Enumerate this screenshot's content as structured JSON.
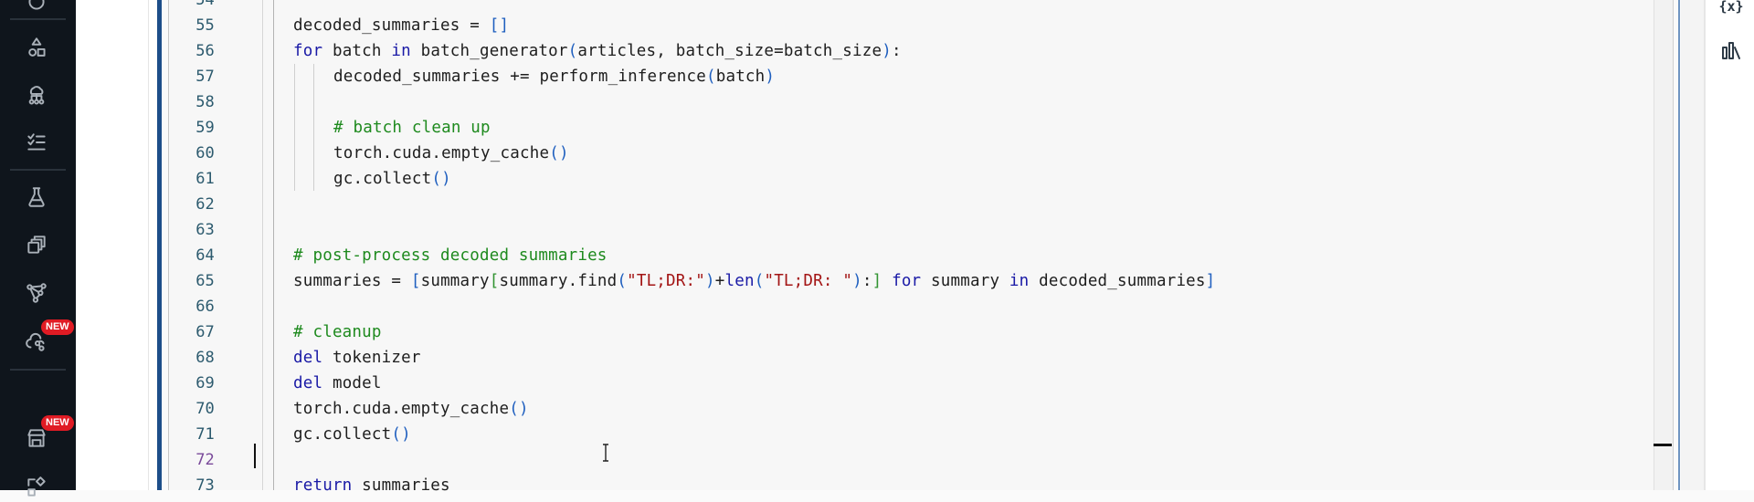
{
  "sidebar": {
    "items": [
      {
        "icon": "shapes-icon",
        "label": "Components"
      },
      {
        "icon": "hierarchy-icon",
        "label": "Pipelines"
      },
      {
        "icon": "checklist-icon",
        "label": "Tasks"
      },
      {
        "icon": "flask-icon",
        "label": "Experiments"
      },
      {
        "icon": "stack-icon",
        "label": "Models"
      },
      {
        "icon": "network-icon",
        "label": "Endpoints"
      },
      {
        "icon": "cloud-link-icon",
        "label": "Connections",
        "badge": "NEW"
      },
      {
        "icon": "store-icon",
        "label": "Marketplace",
        "badge": "NEW"
      },
      {
        "icon": "shapes-tool-icon",
        "label": "Tools"
      }
    ],
    "badge_color": "#e01b24"
  },
  "editor": {
    "top_partial_line": "54",
    "active_line": "72",
    "lines": [
      {
        "num": "55",
        "indent": 0,
        "tokens": [
          {
            "t": "decoded_summaries = ",
            "c": ""
          },
          {
            "t": "[]",
            "c": "br1"
          }
        ]
      },
      {
        "num": "56",
        "indent": 0,
        "tokens": [
          {
            "t": "for",
            "c": "kw"
          },
          {
            "t": " batch ",
            "c": ""
          },
          {
            "t": "in",
            "c": "kw"
          },
          {
            "t": " batch_generator",
            "c": ""
          },
          {
            "t": "(",
            "c": "br1"
          },
          {
            "t": "articles, batch_size=batch_size",
            "c": ""
          },
          {
            "t": ")",
            "c": "br1"
          },
          {
            "t": ":",
            "c": ""
          }
        ]
      },
      {
        "num": "57",
        "indent": 1,
        "tokens": [
          {
            "t": "decoded_summaries += perform_inference",
            "c": ""
          },
          {
            "t": "(",
            "c": "br1"
          },
          {
            "t": "batch",
            "c": ""
          },
          {
            "t": ")",
            "c": "br1"
          }
        ]
      },
      {
        "num": "58",
        "indent": 1,
        "tokens": []
      },
      {
        "num": "59",
        "indent": 1,
        "tokens": [
          {
            "t": "# batch clean up",
            "c": "cm"
          }
        ]
      },
      {
        "num": "60",
        "indent": 1,
        "tokens": [
          {
            "t": "torch.cuda.empty_cache",
            "c": ""
          },
          {
            "t": "()",
            "c": "br1"
          }
        ]
      },
      {
        "num": "61",
        "indent": 1,
        "tokens": [
          {
            "t": "gc.collect",
            "c": ""
          },
          {
            "t": "()",
            "c": "br1"
          }
        ]
      },
      {
        "num": "62",
        "indent": 0,
        "tokens": []
      },
      {
        "num": "63",
        "indent": 0,
        "tokens": []
      },
      {
        "num": "64",
        "indent": 0,
        "tokens": [
          {
            "t": "# post-process decoded summaries",
            "c": "cm"
          }
        ]
      },
      {
        "num": "65",
        "indent": 0,
        "tokens": [
          {
            "t": "summaries = ",
            "c": ""
          },
          {
            "t": "[",
            "c": "br1"
          },
          {
            "t": "summary",
            "c": ""
          },
          {
            "t": "[",
            "c": "br2"
          },
          {
            "t": "summary.find",
            "c": ""
          },
          {
            "t": "(",
            "c": "br1"
          },
          {
            "t": "\"TL;DR:\"",
            "c": "st"
          },
          {
            "t": ")",
            "c": "br1"
          },
          {
            "t": "+",
            "c": ""
          },
          {
            "t": "len",
            "c": "kw"
          },
          {
            "t": "(",
            "c": "br1"
          },
          {
            "t": "\"TL;DR: \"",
            "c": "st"
          },
          {
            "t": ")",
            "c": "br1"
          },
          {
            "t": ":",
            "c": ""
          },
          {
            "t": "]",
            "c": "br2"
          },
          {
            "t": " ",
            "c": ""
          },
          {
            "t": "for",
            "c": "kw"
          },
          {
            "t": " summary ",
            "c": ""
          },
          {
            "t": "in",
            "c": "kw"
          },
          {
            "t": " decoded_summaries",
            "c": ""
          },
          {
            "t": "]",
            "c": "br1"
          }
        ]
      },
      {
        "num": "66",
        "indent": 0,
        "tokens": []
      },
      {
        "num": "67",
        "indent": 0,
        "tokens": [
          {
            "t": "# cleanup",
            "c": "cm"
          }
        ]
      },
      {
        "num": "68",
        "indent": 0,
        "tokens": [
          {
            "t": "del",
            "c": "kw"
          },
          {
            "t": " tokenizer",
            "c": ""
          }
        ]
      },
      {
        "num": "69",
        "indent": 0,
        "tokens": [
          {
            "t": "del",
            "c": "kw"
          },
          {
            "t": " model",
            "c": ""
          }
        ]
      },
      {
        "num": "70",
        "indent": 0,
        "tokens": [
          {
            "t": "torch.cuda.empty_cache",
            "c": ""
          },
          {
            "t": "()",
            "c": "br1"
          }
        ]
      },
      {
        "num": "71",
        "indent": 0,
        "tokens": [
          {
            "t": "gc.collect",
            "c": ""
          },
          {
            "t": "()",
            "c": "br1"
          }
        ]
      },
      {
        "num": "72",
        "indent": 0,
        "tokens": []
      },
      {
        "num": "73",
        "indent": 0,
        "tokens": [
          {
            "t": "return",
            "c": "kw"
          },
          {
            "t": " summaries",
            "c": ""
          }
        ]
      }
    ]
  },
  "right_bar": {
    "items": [
      {
        "icon": "variables-icon",
        "label": "{x}"
      },
      {
        "icon": "bar-chart-icon",
        "label": "Charts"
      }
    ]
  }
}
